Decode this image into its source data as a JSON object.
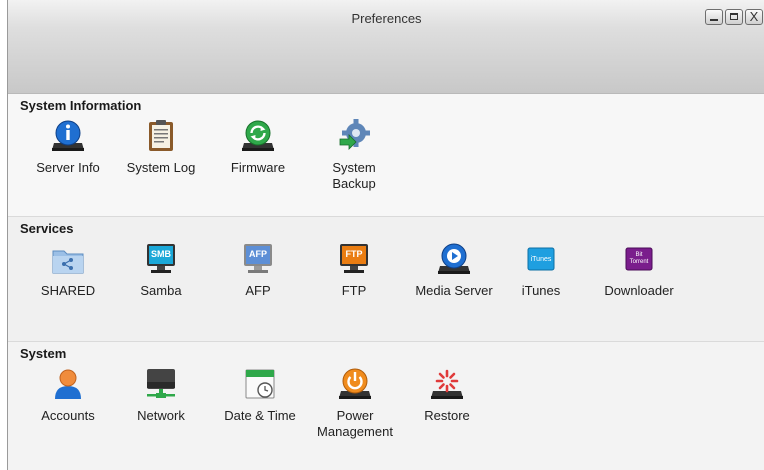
{
  "window": {
    "title": "Preferences",
    "controls": {
      "minimize": "_",
      "maximize": "□",
      "close": "X"
    }
  },
  "sections": [
    {
      "title": "System Information",
      "items": [
        {
          "label": "Server Info",
          "icon": "info-icon"
        },
        {
          "label": "System Log",
          "icon": "clipboard-icon"
        },
        {
          "label": "Firmware",
          "icon": "refresh-drive-icon"
        },
        {
          "label": "System\nBackup",
          "icon": "gear-backup-icon"
        }
      ]
    },
    {
      "title": "Services",
      "items": [
        {
          "label": "SHARED",
          "icon": "shared-folder-icon"
        },
        {
          "label": "Samba",
          "icon": "smb-monitor-icon",
          "badge": "SMB"
        },
        {
          "label": "AFP",
          "icon": "afp-monitor-icon",
          "badge": "AFP"
        },
        {
          "label": "FTP",
          "icon": "ftp-monitor-icon",
          "badge": "FTP"
        },
        {
          "label": "Media Server",
          "icon": "media-play-icon"
        },
        {
          "label": "iTunes",
          "icon": "itunes-icon",
          "badge": "iTunes"
        },
        {
          "label": "Downloader",
          "icon": "bittorrent-icon",
          "badge": "Bit Torrent"
        }
      ]
    },
    {
      "title": "System",
      "items": [
        {
          "label": "Accounts",
          "icon": "user-icon"
        },
        {
          "label": "Network",
          "icon": "network-drive-icon"
        },
        {
          "label": "Date & Time",
          "icon": "calendar-clock-icon"
        },
        {
          "label": "Power\nManagement",
          "icon": "power-icon"
        },
        {
          "label": "Restore",
          "icon": "restore-icon"
        }
      ]
    }
  ],
  "colors": {
    "accent": "#1f6fd1",
    "titlebar": "#cfcfcf"
  }
}
